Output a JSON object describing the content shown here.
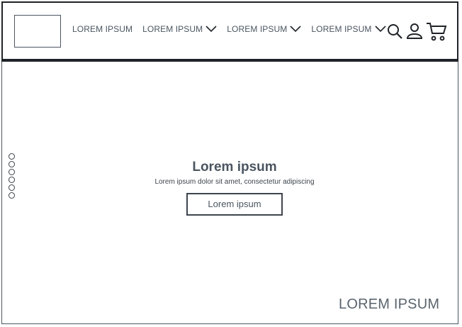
{
  "header": {
    "logo_alt": "",
    "nav": [
      {
        "label": "LOREM IPSUM",
        "has_dropdown": false
      },
      {
        "label": "LOREM IPSUM",
        "has_dropdown": true
      },
      {
        "label": "LOREM IPSUM",
        "has_dropdown": true
      },
      {
        "label": "LOREM IPSUM",
        "has_dropdown": true
      }
    ],
    "icons": [
      "search-icon",
      "user-icon",
      "cart-icon"
    ]
  },
  "carousel": {
    "dot_count": 6
  },
  "hero": {
    "title": "Lorem ipsum",
    "subtitle": "Lorem ipsum dolor sit amet, consectetur adipiscing",
    "button_label": "Lorem ipsum"
  },
  "footer": {
    "label": "LOREM IPSUM"
  },
  "colors": {
    "text": "#4a5560",
    "border": "#1f2328",
    "background": "#ffffff"
  }
}
